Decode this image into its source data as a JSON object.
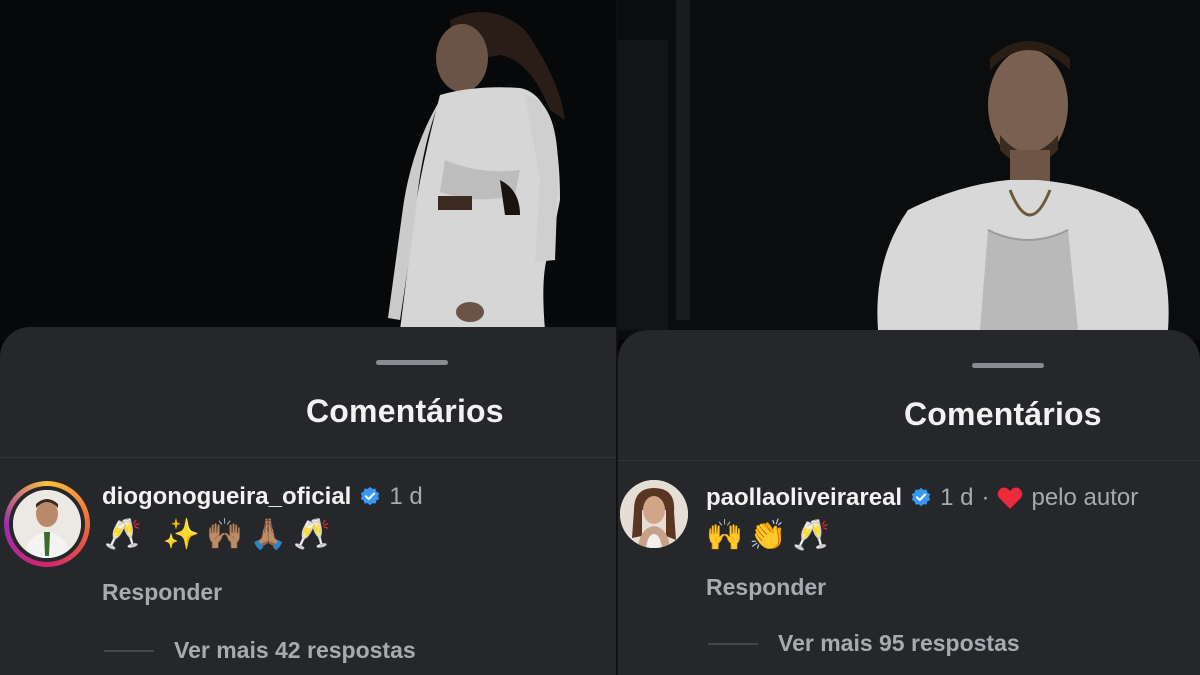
{
  "left": {
    "sheet_title": "Comentários",
    "comment": {
      "username": "diogonogueira_oficial",
      "verified": true,
      "time": "1 d",
      "emojis": "🥂 ✨🙌🏽🙏🏽🥂",
      "reply_label": "Responder",
      "more_replies_label": "Ver mais 42 respostas"
    }
  },
  "right": {
    "sheet_title": "Comentários",
    "comment": {
      "username": "paollaoliveirareal",
      "verified": true,
      "time": "1 d",
      "separator": "·",
      "liked_by_author_label": "pelo autor",
      "emojis": "🙌👏🥂",
      "reply_label": "Responder",
      "more_replies_label": "Ver mais 95 respostas"
    }
  },
  "colors": {
    "sheet_bg": "#25272b",
    "verified_blue": "#3897f0",
    "heart_red": "#ed2a3c",
    "text_primary": "#f2f2f2",
    "text_secondary": "#a8aaaf"
  }
}
